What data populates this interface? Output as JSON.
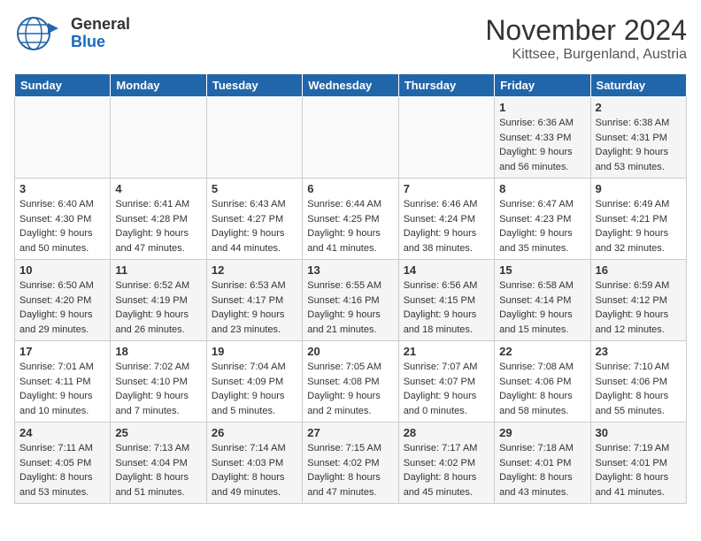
{
  "header": {
    "logo": {
      "general": "General",
      "blue": "Blue"
    },
    "title": "November 2024",
    "subtitle": "Kittsee, Burgenland, Austria"
  },
  "weekdays": [
    "Sunday",
    "Monday",
    "Tuesday",
    "Wednesday",
    "Thursday",
    "Friday",
    "Saturday"
  ],
  "weeks": [
    [
      {
        "day": "",
        "info": ""
      },
      {
        "day": "",
        "info": ""
      },
      {
        "day": "",
        "info": ""
      },
      {
        "day": "",
        "info": ""
      },
      {
        "day": "",
        "info": ""
      },
      {
        "day": "1",
        "info": "Sunrise: 6:36 AM\nSunset: 4:33 PM\nDaylight: 9 hours\nand 56 minutes."
      },
      {
        "day": "2",
        "info": "Sunrise: 6:38 AM\nSunset: 4:31 PM\nDaylight: 9 hours\nand 53 minutes."
      }
    ],
    [
      {
        "day": "3",
        "info": "Sunrise: 6:40 AM\nSunset: 4:30 PM\nDaylight: 9 hours\nand 50 minutes."
      },
      {
        "day": "4",
        "info": "Sunrise: 6:41 AM\nSunset: 4:28 PM\nDaylight: 9 hours\nand 47 minutes."
      },
      {
        "day": "5",
        "info": "Sunrise: 6:43 AM\nSunset: 4:27 PM\nDaylight: 9 hours\nand 44 minutes."
      },
      {
        "day": "6",
        "info": "Sunrise: 6:44 AM\nSunset: 4:25 PM\nDaylight: 9 hours\nand 41 minutes."
      },
      {
        "day": "7",
        "info": "Sunrise: 6:46 AM\nSunset: 4:24 PM\nDaylight: 9 hours\nand 38 minutes."
      },
      {
        "day": "8",
        "info": "Sunrise: 6:47 AM\nSunset: 4:23 PM\nDaylight: 9 hours\nand 35 minutes."
      },
      {
        "day": "9",
        "info": "Sunrise: 6:49 AM\nSunset: 4:21 PM\nDaylight: 9 hours\nand 32 minutes."
      }
    ],
    [
      {
        "day": "10",
        "info": "Sunrise: 6:50 AM\nSunset: 4:20 PM\nDaylight: 9 hours\nand 29 minutes."
      },
      {
        "day": "11",
        "info": "Sunrise: 6:52 AM\nSunset: 4:19 PM\nDaylight: 9 hours\nand 26 minutes."
      },
      {
        "day": "12",
        "info": "Sunrise: 6:53 AM\nSunset: 4:17 PM\nDaylight: 9 hours\nand 23 minutes."
      },
      {
        "day": "13",
        "info": "Sunrise: 6:55 AM\nSunset: 4:16 PM\nDaylight: 9 hours\nand 21 minutes."
      },
      {
        "day": "14",
        "info": "Sunrise: 6:56 AM\nSunset: 4:15 PM\nDaylight: 9 hours\nand 18 minutes."
      },
      {
        "day": "15",
        "info": "Sunrise: 6:58 AM\nSunset: 4:14 PM\nDaylight: 9 hours\nand 15 minutes."
      },
      {
        "day": "16",
        "info": "Sunrise: 6:59 AM\nSunset: 4:12 PM\nDaylight: 9 hours\nand 12 minutes."
      }
    ],
    [
      {
        "day": "17",
        "info": "Sunrise: 7:01 AM\nSunset: 4:11 PM\nDaylight: 9 hours\nand 10 minutes."
      },
      {
        "day": "18",
        "info": "Sunrise: 7:02 AM\nSunset: 4:10 PM\nDaylight: 9 hours\nand 7 minutes."
      },
      {
        "day": "19",
        "info": "Sunrise: 7:04 AM\nSunset: 4:09 PM\nDaylight: 9 hours\nand 5 minutes."
      },
      {
        "day": "20",
        "info": "Sunrise: 7:05 AM\nSunset: 4:08 PM\nDaylight: 9 hours\nand 2 minutes."
      },
      {
        "day": "21",
        "info": "Sunrise: 7:07 AM\nSunset: 4:07 PM\nDaylight: 9 hours\nand 0 minutes."
      },
      {
        "day": "22",
        "info": "Sunrise: 7:08 AM\nSunset: 4:06 PM\nDaylight: 8 hours\nand 58 minutes."
      },
      {
        "day": "23",
        "info": "Sunrise: 7:10 AM\nSunset: 4:06 PM\nDaylight: 8 hours\nand 55 minutes."
      }
    ],
    [
      {
        "day": "24",
        "info": "Sunrise: 7:11 AM\nSunset: 4:05 PM\nDaylight: 8 hours\nand 53 minutes."
      },
      {
        "day": "25",
        "info": "Sunrise: 7:13 AM\nSunset: 4:04 PM\nDaylight: 8 hours\nand 51 minutes."
      },
      {
        "day": "26",
        "info": "Sunrise: 7:14 AM\nSunset: 4:03 PM\nDaylight: 8 hours\nand 49 minutes."
      },
      {
        "day": "27",
        "info": "Sunrise: 7:15 AM\nSunset: 4:02 PM\nDaylight: 8 hours\nand 47 minutes."
      },
      {
        "day": "28",
        "info": "Sunrise: 7:17 AM\nSunset: 4:02 PM\nDaylight: 8 hours\nand 45 minutes."
      },
      {
        "day": "29",
        "info": "Sunrise: 7:18 AM\nSunset: 4:01 PM\nDaylight: 8 hours\nand 43 minutes."
      },
      {
        "day": "30",
        "info": "Sunrise: 7:19 AM\nSunset: 4:01 PM\nDaylight: 8 hours\nand 41 minutes."
      }
    ]
  ]
}
